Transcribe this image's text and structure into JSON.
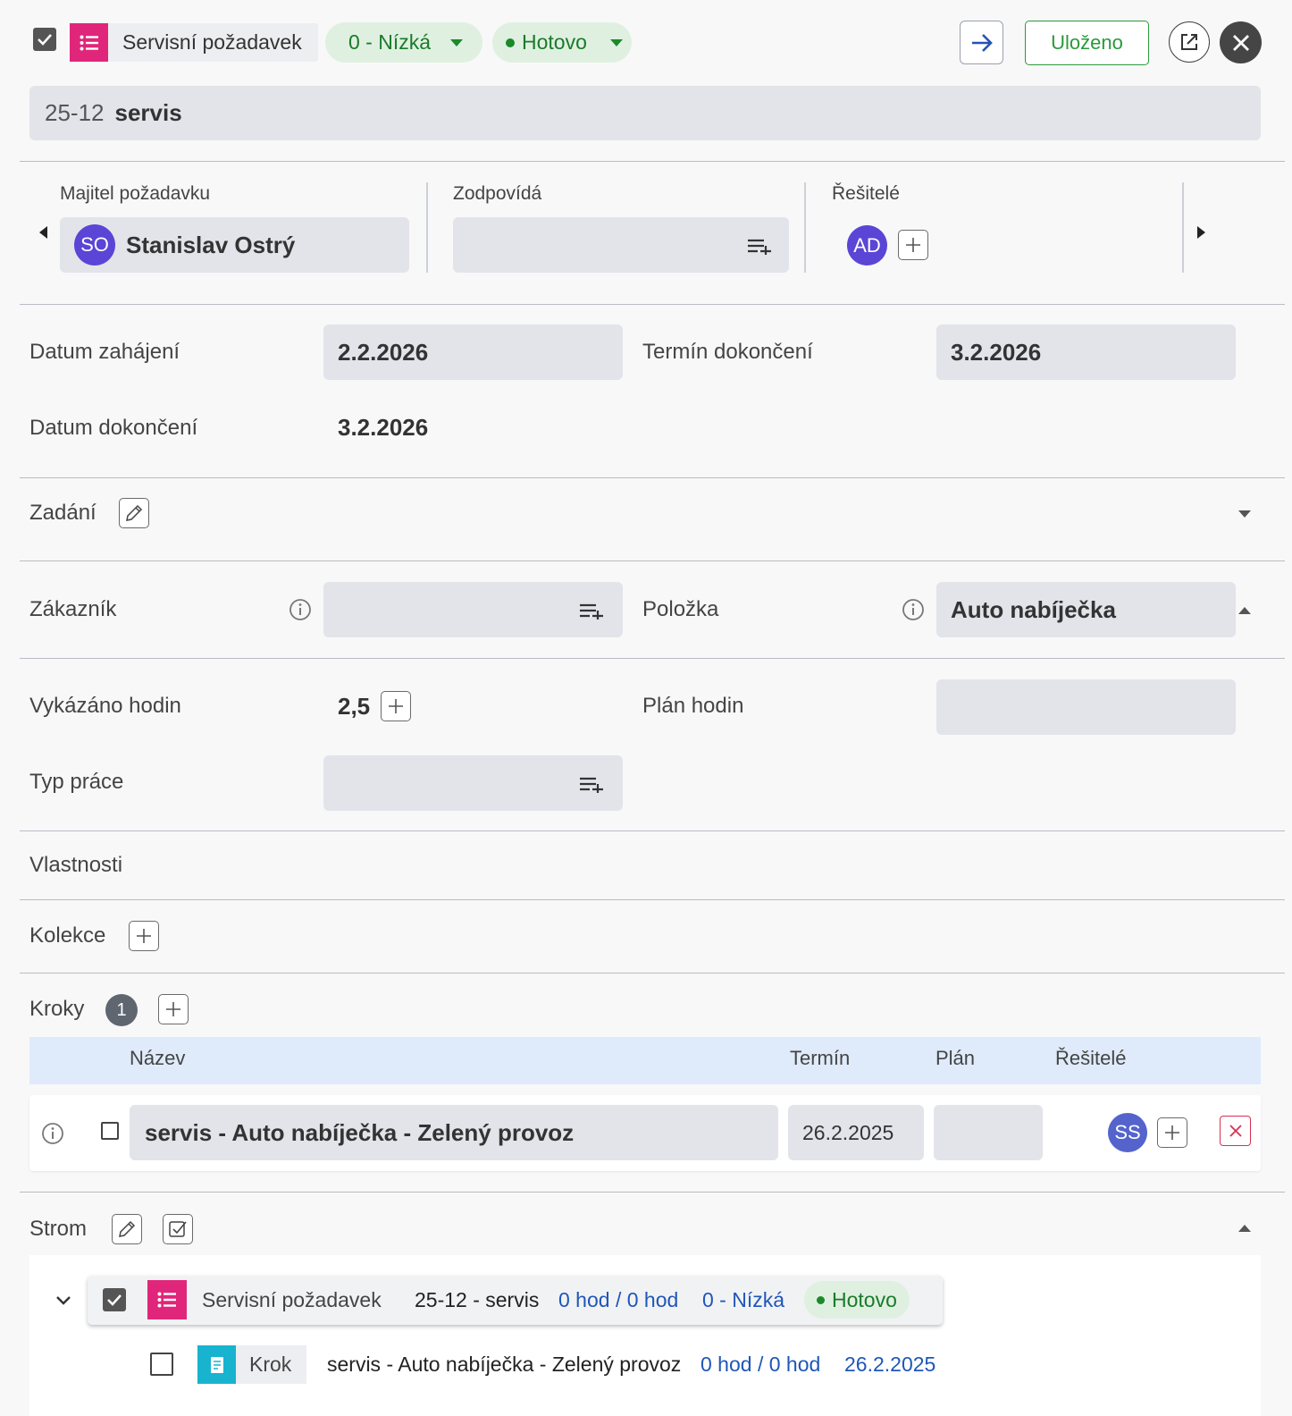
{
  "header": {
    "type_label": "Servisní požadavek",
    "priority": "0 - Nízká",
    "status": "Hotovo",
    "saved_label": "Uloženo",
    "colors": {
      "type_icon": "#e0267a",
      "priority_bg": "#dff0e0",
      "status_dot": "#1a8a2a",
      "saved_border": "#2a9a3a",
      "saved_text": "#2a9a3a"
    }
  },
  "title": {
    "number": "25-12",
    "name": "servis"
  },
  "people": {
    "owner_label": "Majitel požadavku",
    "owner_initials": "SO",
    "owner_name": "Stanislav Ostrý",
    "responsible_label": "Zodpovídá",
    "solvers_label": "Řešitelé",
    "solver_initials": "AD"
  },
  "dates": {
    "start_label": "Datum zahájení",
    "start_value": "2.2.2026",
    "deadline_label": "Termín dokončení",
    "deadline_value": "3.2.2026",
    "completed_label": "Datum dokončení",
    "completed_value": "3.2.2026"
  },
  "assignment": {
    "label": "Zadání"
  },
  "customer": {
    "label": "Zákazník",
    "item_label": "Položka",
    "item_value": "Auto nabíječka"
  },
  "hours": {
    "reported_label": "Vykázáno hodin",
    "reported_value": "2,5",
    "plan_label": "Plán hodin",
    "work_type_label": "Typ práce"
  },
  "properties": {
    "label": "Vlastnosti"
  },
  "collection": {
    "label": "Kolekce"
  },
  "steps": {
    "label": "Kroky",
    "count": "1",
    "columns": {
      "name": "Název",
      "deadline": "Termín",
      "plan": "Plán",
      "solvers": "Řešitelé"
    },
    "rows": [
      {
        "name": "servis - Auto nabíječka - Zelený provoz",
        "deadline": "26.2.2025",
        "plan": "",
        "solver_initials": "SS"
      }
    ]
  },
  "tree": {
    "label": "Strom",
    "root": {
      "type": "Servisní požadavek",
      "title": "25-12 - servis",
      "hours": "0 hod / 0 hod",
      "priority": "0 - Nízká",
      "status": "Hotovo"
    },
    "child": {
      "type": "Krok",
      "title": "servis - Auto nabíječka - Zelený provoz",
      "hours": "0 hod / 0 hod",
      "deadline": "26.2.2025"
    }
  }
}
